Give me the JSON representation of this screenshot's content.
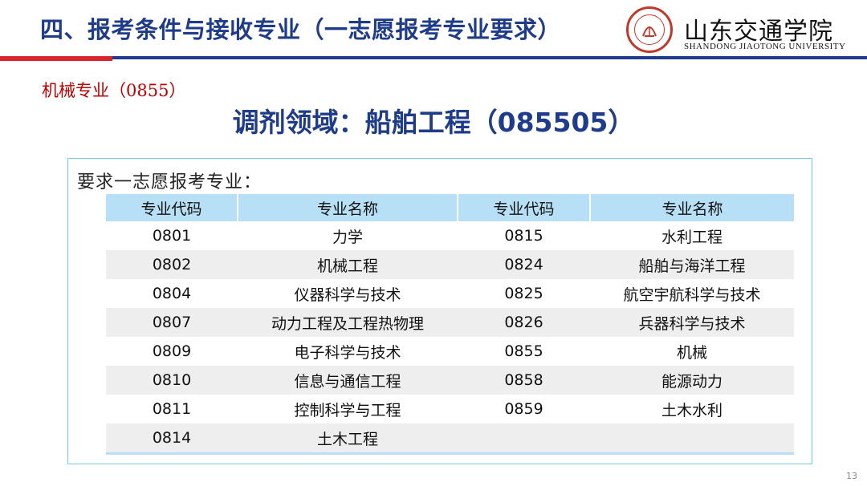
{
  "header": {
    "title": "四、报考条件与接收专业（一志愿报考专业要求）",
    "logo_cn": "山东交通学院",
    "logo_en": "SHANDONG JIAOTONG UNIVERSITY",
    "colors": {
      "title": "#1f3c8a",
      "rule": "#1f3c8a",
      "accent": "#d8262c"
    }
  },
  "major_label": "机械专业（0855）",
  "field_title": "调剂领域：船舶工程（085505）",
  "requirement_label": "要求一志愿报考专业：",
  "table": {
    "headers": [
      "专业代码",
      "专业名称",
      "专业代码",
      "专业名称"
    ],
    "rows": [
      [
        "0801",
        "力学",
        "0815",
        "水利工程"
      ],
      [
        "0802",
        "机械工程",
        "0824",
        "船舶与海洋工程"
      ],
      [
        "0804",
        "仪器科学与技术",
        "0825",
        "航空宇航科学与技术"
      ],
      [
        "0807",
        "动力工程及工程热物理",
        "0826",
        "兵器科学与技术"
      ],
      [
        "0809",
        "电子科学与技术",
        "0855",
        "机械"
      ],
      [
        "0810",
        "信息与通信工程",
        "0858",
        "能源动力"
      ],
      [
        "0811",
        "控制科学与工程",
        "0859",
        "土木水利"
      ],
      [
        "0814",
        "土木工程",
        "",
        ""
      ]
    ]
  },
  "page_number": "13"
}
